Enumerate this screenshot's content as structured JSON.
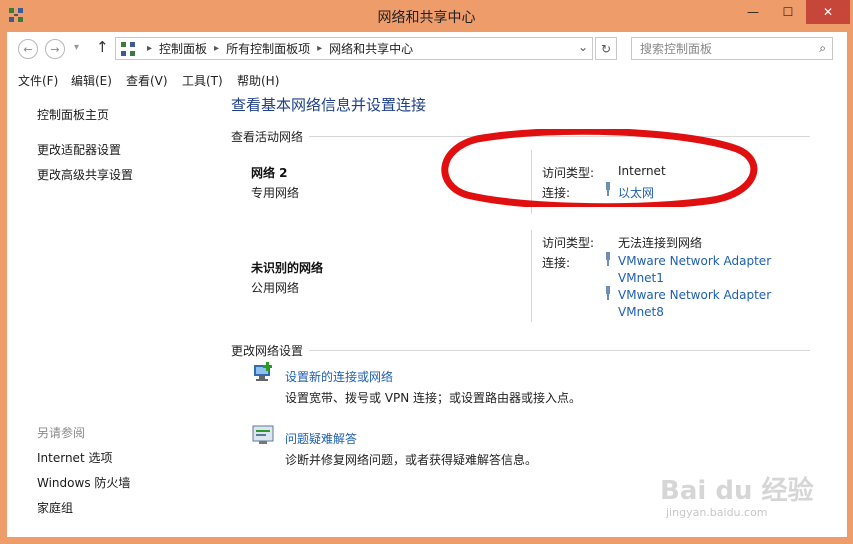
{
  "window": {
    "title": "网络和共享中心",
    "min_glyph": "—",
    "max_glyph": "☐",
    "close_glyph": "✕"
  },
  "address": {
    "back_glyph": "←",
    "forward_glyph": "→",
    "dropdown_glyph": "▾",
    "up_glyph": "↑",
    "crumbs": [
      "控制面板",
      "所有控制面板项",
      "网络和共享中心"
    ],
    "sep_glyph": "▸",
    "history_glyph": "⌄",
    "refresh_glyph": "↻",
    "search_placeholder": "搜索控制面板",
    "search_glyph": "⌕"
  },
  "menu": {
    "items": [
      "文件(F)",
      "编辑(E)",
      "查看(V)",
      "工具(T)",
      "帮助(H)"
    ]
  },
  "sidebar": {
    "links": [
      "控制面板主页",
      "更改适配器设置",
      "更改高级共享设置"
    ],
    "see_also_heading": "另请参阅",
    "see_also": [
      "Internet 选项",
      "Windows 防火墙",
      "家庭组"
    ]
  },
  "main": {
    "title": "查看基本网络信息并设置连接",
    "active_heading": "查看活动网络",
    "networks": [
      {
        "name": "网络  2",
        "type": "专用网络",
        "access_label": "访问类型:",
        "access_value": "Internet",
        "conn_label": "连接:",
        "connections": [
          "以太网"
        ]
      },
      {
        "name": "未识别的网络",
        "type": "公用网络",
        "access_label": "访问类型:",
        "access_value": "无法连接到网络",
        "conn_label": "连接:",
        "connections": [
          "VMware Network Adapter",
          "VMnet1",
          "VMware Network Adapter",
          "VMnet8"
        ]
      }
    ],
    "change_heading": "更改网络设置",
    "actions": [
      {
        "title": "设置新的连接或网络",
        "desc": "设置宽带、拨号或 VPN 连接；或设置路由器或接入点。"
      },
      {
        "title": "问题疑难解答",
        "desc": "诊断并修复网络问题，或者获得疑难解答信息。"
      }
    ]
  },
  "watermark": {
    "brand": "Bai du 经验",
    "url": "jingyan.baidu.com"
  },
  "colors": {
    "frame": "#ee9c6a",
    "link": "#1e5fb4",
    "title": "#1e3f8a",
    "annotation": "#e01010",
    "close": "#c7463a"
  }
}
